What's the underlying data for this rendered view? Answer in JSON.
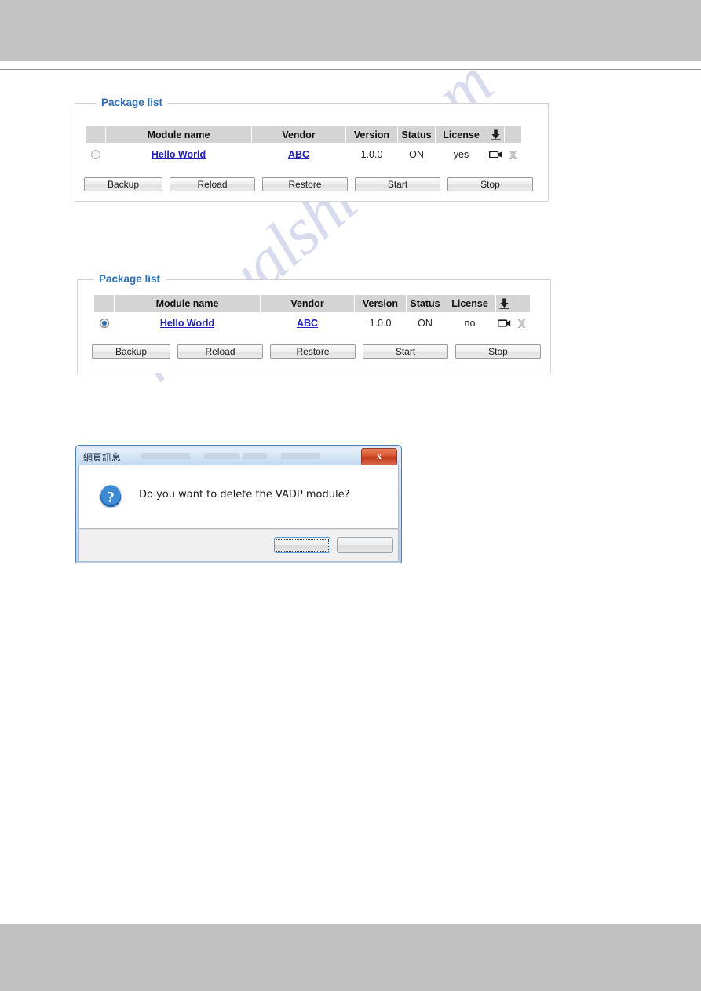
{
  "watermark": {
    "text": "manualshive.com"
  },
  "panels": [
    {
      "legend": "Package list",
      "columns": [
        "",
        "Module name",
        "Vendor",
        "Version",
        "Status",
        "License",
        "download-icon",
        ""
      ],
      "row": {
        "selected": false,
        "module_name": "Hello World",
        "vendor": "ABC",
        "version": "1.0.0",
        "status": "ON",
        "license": "yes",
        "camera_icon": "video-camera-icon",
        "delete_icon": "delete-icon"
      },
      "buttons": [
        "Backup",
        "Reload",
        "Restore",
        "Start",
        "Stop"
      ]
    },
    {
      "legend": "Package list",
      "columns": [
        "",
        "Module name",
        "Vendor",
        "Version",
        "Status",
        "License",
        "download-icon",
        ""
      ],
      "row": {
        "selected": true,
        "module_name": "Hello World",
        "vendor": "ABC",
        "version": "1.0.0",
        "status": "ON",
        "license": "no",
        "camera_icon": "video-camera-icon",
        "delete_icon": "delete-icon"
      },
      "buttons": [
        "Backup",
        "Reload",
        "Restore",
        "Start",
        "Stop"
      ]
    }
  ],
  "dialog": {
    "title": "網頁訊息",
    "close_label": "x",
    "icon": "question-mark-icon",
    "message": "Do you want to delete the VADP module?",
    "buttons": [
      {
        "label": "",
        "default": true
      },
      {
        "label": "",
        "default": false
      }
    ]
  },
  "colors": {
    "legend_blue": "#2f6fb8",
    "link_blue": "#2222bb",
    "header_gray": "#d4d4d4",
    "band_gray": "#c3c3c3",
    "radio_blue": "#2a6fb0",
    "close_red": "#d9542f"
  }
}
